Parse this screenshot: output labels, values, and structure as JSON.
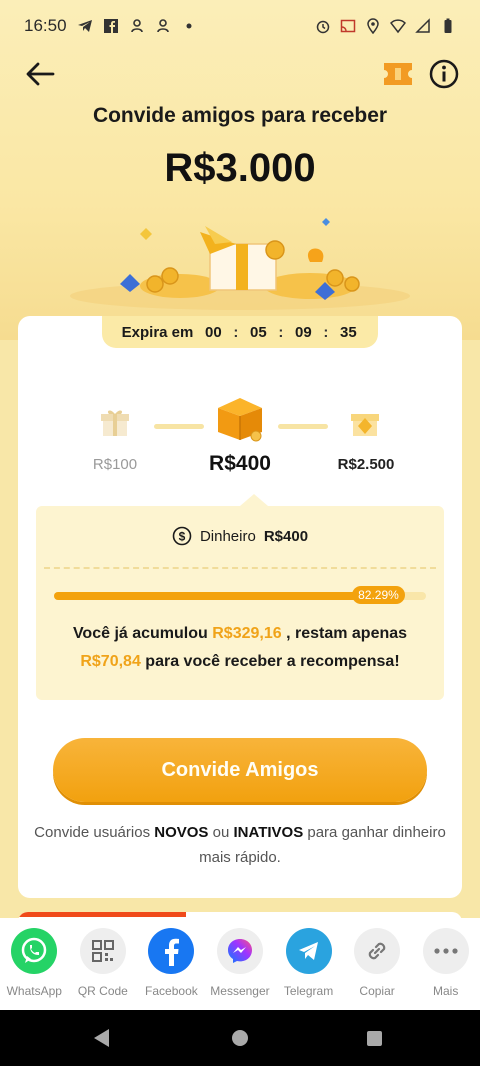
{
  "status_bar": {
    "time": "16:50",
    "left_icons": [
      "telegram-icon",
      "facebook-icon",
      "app-icon",
      "app-icon",
      "dot-icon"
    ],
    "right_icons": [
      "alarm-icon",
      "cast-icon",
      "location-icon",
      "wifi-icon",
      "signal-icon",
      "battery-icon"
    ]
  },
  "header": {
    "title": "Convide amigos para receber",
    "amount": "R$3.000"
  },
  "countdown": {
    "label": "Expira em",
    "hours": "00",
    "minutes": "05",
    "seconds": "09",
    "centis": "35",
    "separator": ":"
  },
  "tiers": [
    {
      "label": "R$100",
      "state": "done"
    },
    {
      "label": "R$400",
      "state": "current"
    },
    {
      "label": "R$2.500",
      "state": "locked"
    }
  ],
  "reward": {
    "type_label": "Dinheiro",
    "value": "R$400",
    "progress_percent": 82.29,
    "progress_label": "82.29%",
    "text_1": "Você já acumulou",
    "accumulated": "R$329,16",
    "text_2": ", restam apenas",
    "remaining": "R$70,84",
    "text_3": "para você receber a recompensa!"
  },
  "invite_button": {
    "label": "Convide Amigos"
  },
  "hint": {
    "part_1": "Convide usuários",
    "bold_1": "NOVOS",
    "part_2": "ou",
    "bold_2": "INATIVOS",
    "part_3": "para ganhar dinheiro mais rápido."
  },
  "share": [
    {
      "label": "WhatsApp",
      "icon": "whatsapp-icon",
      "color": "#25d366"
    },
    {
      "label": "QR Code",
      "icon": "qr-code-icon",
      "color": "#eeeeee"
    },
    {
      "label": "Facebook",
      "icon": "facebook-icon",
      "color": "#1877f2"
    },
    {
      "label": "Messenger",
      "icon": "messenger-icon",
      "color": "#eeeeee"
    },
    {
      "label": "Telegram",
      "icon": "telegram-icon",
      "color": "#2aa3df"
    },
    {
      "label": "Copiar",
      "icon": "link-icon",
      "color": "#eeeeee"
    },
    {
      "label": "Mais",
      "icon": "more-icon",
      "color": "#eeeeee"
    }
  ],
  "colors": {
    "accent": "#f3a20d",
    "highlight_text": "#f0a319",
    "page_bg": "#f8e7a8"
  }
}
